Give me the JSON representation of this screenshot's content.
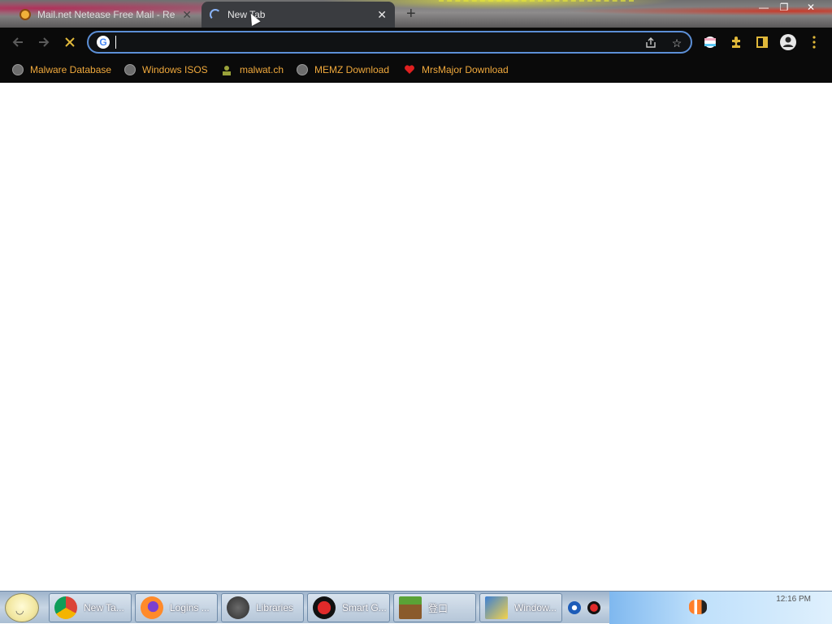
{
  "tabs": [
    {
      "title": "Mail.net Netease Free Mail - Re",
      "active": false
    },
    {
      "title": "New Tab",
      "active": true
    }
  ],
  "toolbar": {
    "omnibox_value": "",
    "omnibox_placeholder": ""
  },
  "bookmarks": [
    {
      "label": "Malware Database",
      "icon": "globe-icon"
    },
    {
      "label": "Windows ISOS",
      "icon": "globe-icon"
    },
    {
      "label": "malwat.ch",
      "icon": "malwatch-icon"
    },
    {
      "label": "MEMZ Download",
      "icon": "globe-icon"
    },
    {
      "label": "MrsMajor Download",
      "icon": "heart-icon"
    }
  ],
  "taskbar": {
    "items": [
      {
        "label": "New Ta...",
        "icon": "chrome-icon"
      },
      {
        "label": "Logins ...",
        "icon": "firefox-icon"
      },
      {
        "label": "Libraries",
        "icon": "libraries-icon"
      },
      {
        "label": "Smart G...",
        "icon": "smart-icon"
      },
      {
        "label": "登口",
        "icon": "minecraft-icon"
      },
      {
        "label": "Window...",
        "icon": "windows-installer-icon"
      }
    ],
    "clock": "12:16 PM"
  },
  "colors": {
    "accent": "#5c8fd6",
    "bookmark_text": "#f0a93c",
    "toolbar_bg": "#0a0a0a",
    "extension_icon": "#e0b83a"
  }
}
